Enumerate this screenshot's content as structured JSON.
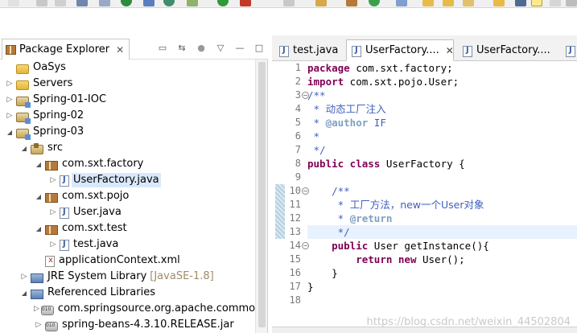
{
  "package_explorer": {
    "title": "Package Explorer",
    "tree": [
      {
        "label": "OaSys",
        "icon": "folder-icon",
        "arrow": "",
        "indent": 0
      },
      {
        "label": "Servers",
        "icon": "folder-icon",
        "arrow": ">",
        "indent": 0
      },
      {
        "label": "Spring-01-IOC",
        "icon": "project-icon",
        "arrow": ">",
        "indent": 0
      },
      {
        "label": "Spring-02",
        "icon": "project-icon",
        "arrow": ">",
        "indent": 0
      },
      {
        "label": "Spring-03",
        "icon": "project-icon",
        "arrow": "v",
        "indent": 0
      },
      {
        "label": "src",
        "icon": "source-folder-icon",
        "arrow": "v",
        "indent": 1
      },
      {
        "label": "com.sxt.factory",
        "icon": "package-icon",
        "arrow": "v",
        "indent": 2
      },
      {
        "label": "UserFactory.java",
        "icon": "java-file-icon",
        "arrow": ">",
        "indent": 3,
        "selected": true
      },
      {
        "label": "com.sxt.pojo",
        "icon": "package-icon",
        "arrow": "v",
        "indent": 2
      },
      {
        "label": "User.java",
        "icon": "java-file-icon",
        "arrow": ">",
        "indent": 3
      },
      {
        "label": "com.sxt.test",
        "icon": "package-icon",
        "arrow": "v",
        "indent": 2
      },
      {
        "label": "test.java",
        "icon": "java-file-icon",
        "arrow": ">",
        "indent": 3
      },
      {
        "label": "applicationContext.xml",
        "icon": "xml-file-icon",
        "arrow": "",
        "indent": 2
      },
      {
        "label": "JRE System Library",
        "suffix": "[JavaSE-1.8]",
        "icon": "library-icon",
        "arrow": ">",
        "indent": 1
      },
      {
        "label": "Referenced Libraries",
        "icon": "library-icon",
        "arrow": "v",
        "indent": 1
      },
      {
        "label": "com.springsource.org.apache.commons.",
        "icon": "jar-icon",
        "arrow": ">",
        "indent": 2
      },
      {
        "label": "spring-beans-4.3.10.RELEASE.jar",
        "icon": "jar-icon",
        "arrow": ">",
        "indent": 2
      }
    ]
  },
  "editor": {
    "tabs": [
      {
        "label": "test.java",
        "active": false
      },
      {
        "label": "UserFactory....",
        "active": true
      },
      {
        "label": "UserFactory....",
        "active": false
      }
    ],
    "line_numbers": [
      "1",
      "2",
      "3",
      "4",
      "5",
      "6",
      "7",
      "8",
      "9",
      "10",
      "11",
      "12",
      "13",
      "14",
      "15",
      "16",
      "17",
      "18"
    ],
    "code": {
      "l1_kw": "package",
      "l1_rest": " com.sxt.factory;",
      "l2_kw": "import",
      "l2_rest": " com.sxt.pojo.User;",
      "l3": "/**",
      "l4_a": " * ",
      "l4_b": "动态工厂注入",
      "l5_a": " * ",
      "l5_tag": "@author",
      "l5_b": " IF",
      "l6": " *",
      "l7": " */",
      "l8_kw1": "public",
      "l8_kw2": " class",
      "l8_rest": " UserFactory {",
      "l9": "",
      "l10": "    /**",
      "l11_a": "     * ",
      "l11_b": "工厂方法，new一个User对象",
      "l12_a": "     * ",
      "l12_tag": "@return",
      "l13": "     */",
      "l14_indent": "    ",
      "l14_kw": "public",
      "l14_rest": " User getInstance(){",
      "l15_indent": "        ",
      "l15_kw1": "return",
      "l15_kw2": " new",
      "l15_rest": " User();",
      "l16": "    }",
      "l17": "}",
      "l18": ""
    }
  },
  "watermark": "https://blog.csdn.net/weixin_44502804",
  "colors": {
    "keyword": "#7f0055",
    "comment": "#3f5fbf",
    "selection": "#d9e8fb",
    "current_line": "#e8f2fe"
  }
}
